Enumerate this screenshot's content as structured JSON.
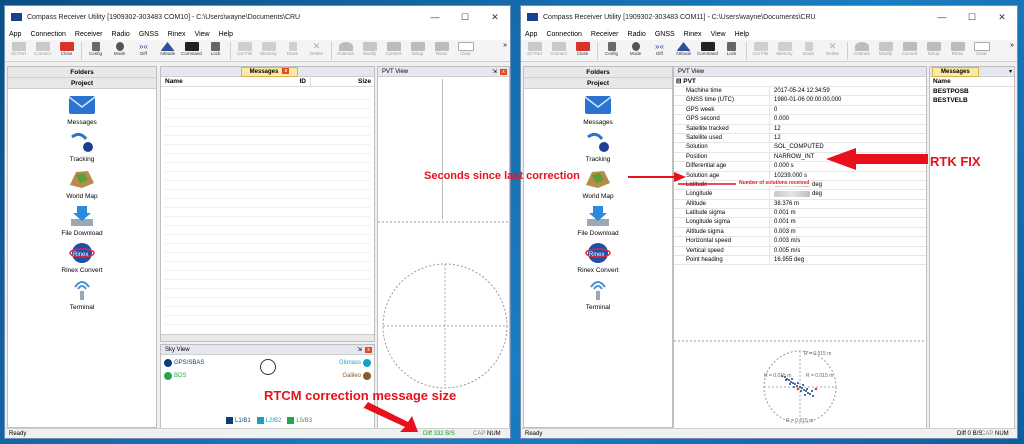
{
  "left_window": {
    "title": "Compass Receiver Utility [1909302-303483 COM10] - C:\\Users\\wayne\\Documents\\CRU",
    "menu": [
      "App",
      "Connection",
      "Receiver",
      "Radio",
      "GNSS",
      "Rinex",
      "View",
      "Help"
    ],
    "toolbar": [
      "Srl Port",
      "Connect",
      "Close",
      "Config",
      "Mode",
      "Diff",
      "Attitude",
      "Command",
      "Lock",
      "List File",
      "Memory",
      "Down",
      "Delete",
      "Antenna",
      "Modify",
      "Convert",
      "Setup",
      "Rinex",
      "Clear"
    ],
    "sidebar": {
      "folders": "Folders",
      "project": "Project",
      "items": [
        "Messages",
        "Tracking",
        "World Map",
        "File Download",
        "Rinex Convert",
        "Terminal"
      ]
    },
    "messages_tab": "Messages",
    "columns": [
      "Name",
      "ID",
      "Size"
    ],
    "pvt_title": "PVT View",
    "sky_view": {
      "title": "Sky View",
      "legend": [
        "GPS/SBAS",
        "BDS",
        "Glonass",
        "Galileo"
      ],
      "bands": [
        "L1/B1",
        "L2/B2",
        "L5/B3"
      ]
    },
    "status": {
      "left": "Ready",
      "diff": "Diff 332 B/S",
      "cap": "CAP",
      "num": "NUM"
    }
  },
  "right_window": {
    "title": "Compass Receiver Utility [1909302-303483 COM11] - C:\\Users\\wayne\\Documents\\CRU",
    "menu": [
      "App",
      "Connection",
      "Receiver",
      "Radio",
      "GNSS",
      "Rinex",
      "View",
      "Help"
    ],
    "toolbar": [
      "Srl Port",
      "Connect",
      "Close",
      "Config",
      "Mode",
      "Diff",
      "Attitude",
      "Command",
      "Lock",
      "List File",
      "Memory",
      "Down",
      "Delete",
      "Antenna",
      "Modify",
      "Convert",
      "Setup",
      "Rinex",
      "Clear"
    ],
    "sidebar": {
      "folders": "Folders",
      "project": "Project",
      "items": [
        "Messages",
        "Tracking",
        "World Map",
        "File Download",
        "Rinex Convert",
        "Terminal"
      ]
    },
    "pvt_title": "PVT View",
    "pvt_group": "PVT",
    "pvt_rows": [
      {
        "k": "Machine time",
        "v": "2017-05-24 12:34:59"
      },
      {
        "k": "GNSS time (UTC)",
        "v": "1980-01-06 00:00:00.000"
      },
      {
        "k": "GPS week",
        "v": "0"
      },
      {
        "k": "GPS second",
        "v": "0.000"
      },
      {
        "k": "Satellite tracked",
        "v": "12"
      },
      {
        "k": "Satellite used",
        "v": "12"
      },
      {
        "k": "Solution",
        "v": "SOL_COMPUTED"
      },
      {
        "k": "Position",
        "v": "NARROW_INT"
      },
      {
        "k": "Differential age",
        "v": "0.000 s"
      },
      {
        "k": "Solution age",
        "v": "10239.000 s"
      },
      {
        "k": "Latitude",
        "v": "deg"
      },
      {
        "k": "Longitude",
        "v": "deg"
      },
      {
        "k": "Altitude",
        "v": "38.376 m"
      },
      {
        "k": "Latitude sigma",
        "v": "0.001 m"
      },
      {
        "k": "Longitude sigma",
        "v": "0.001 m"
      },
      {
        "k": "Altitude sigma",
        "v": "0.003 m"
      },
      {
        "k": "Horizontal speed",
        "v": "0.003 m/s"
      },
      {
        "k": "Vertical speed",
        "v": "0.005 m/s"
      },
      {
        "k": "Point heading",
        "v": "16.955 deg"
      }
    ],
    "radius_labels": [
      "R = 0.015 m",
      "R = 0.015 m",
      "R = 0.015 m",
      "R = 0.015 m"
    ],
    "messages_tab": "Messages",
    "messages_header": "Name",
    "messages": [
      "BESTPOSB",
      "BESTVELB"
    ],
    "status": {
      "left": "Ready",
      "diff": "Diff 0 B/S",
      "cap": "CAP",
      "num": "NUM"
    }
  },
  "annotations": {
    "seconds": "Seconds since last correction",
    "rtk": "RTK FIX",
    "solutions": "Number of solutions received",
    "rtcm": "RTCM correction message size"
  },
  "colors": {
    "annotation": "#e8111b",
    "gps": "#0b3d7a",
    "bds": "#1fa84a",
    "glonass": "#1aa0c8",
    "galileo": "#8a5a2b"
  }
}
